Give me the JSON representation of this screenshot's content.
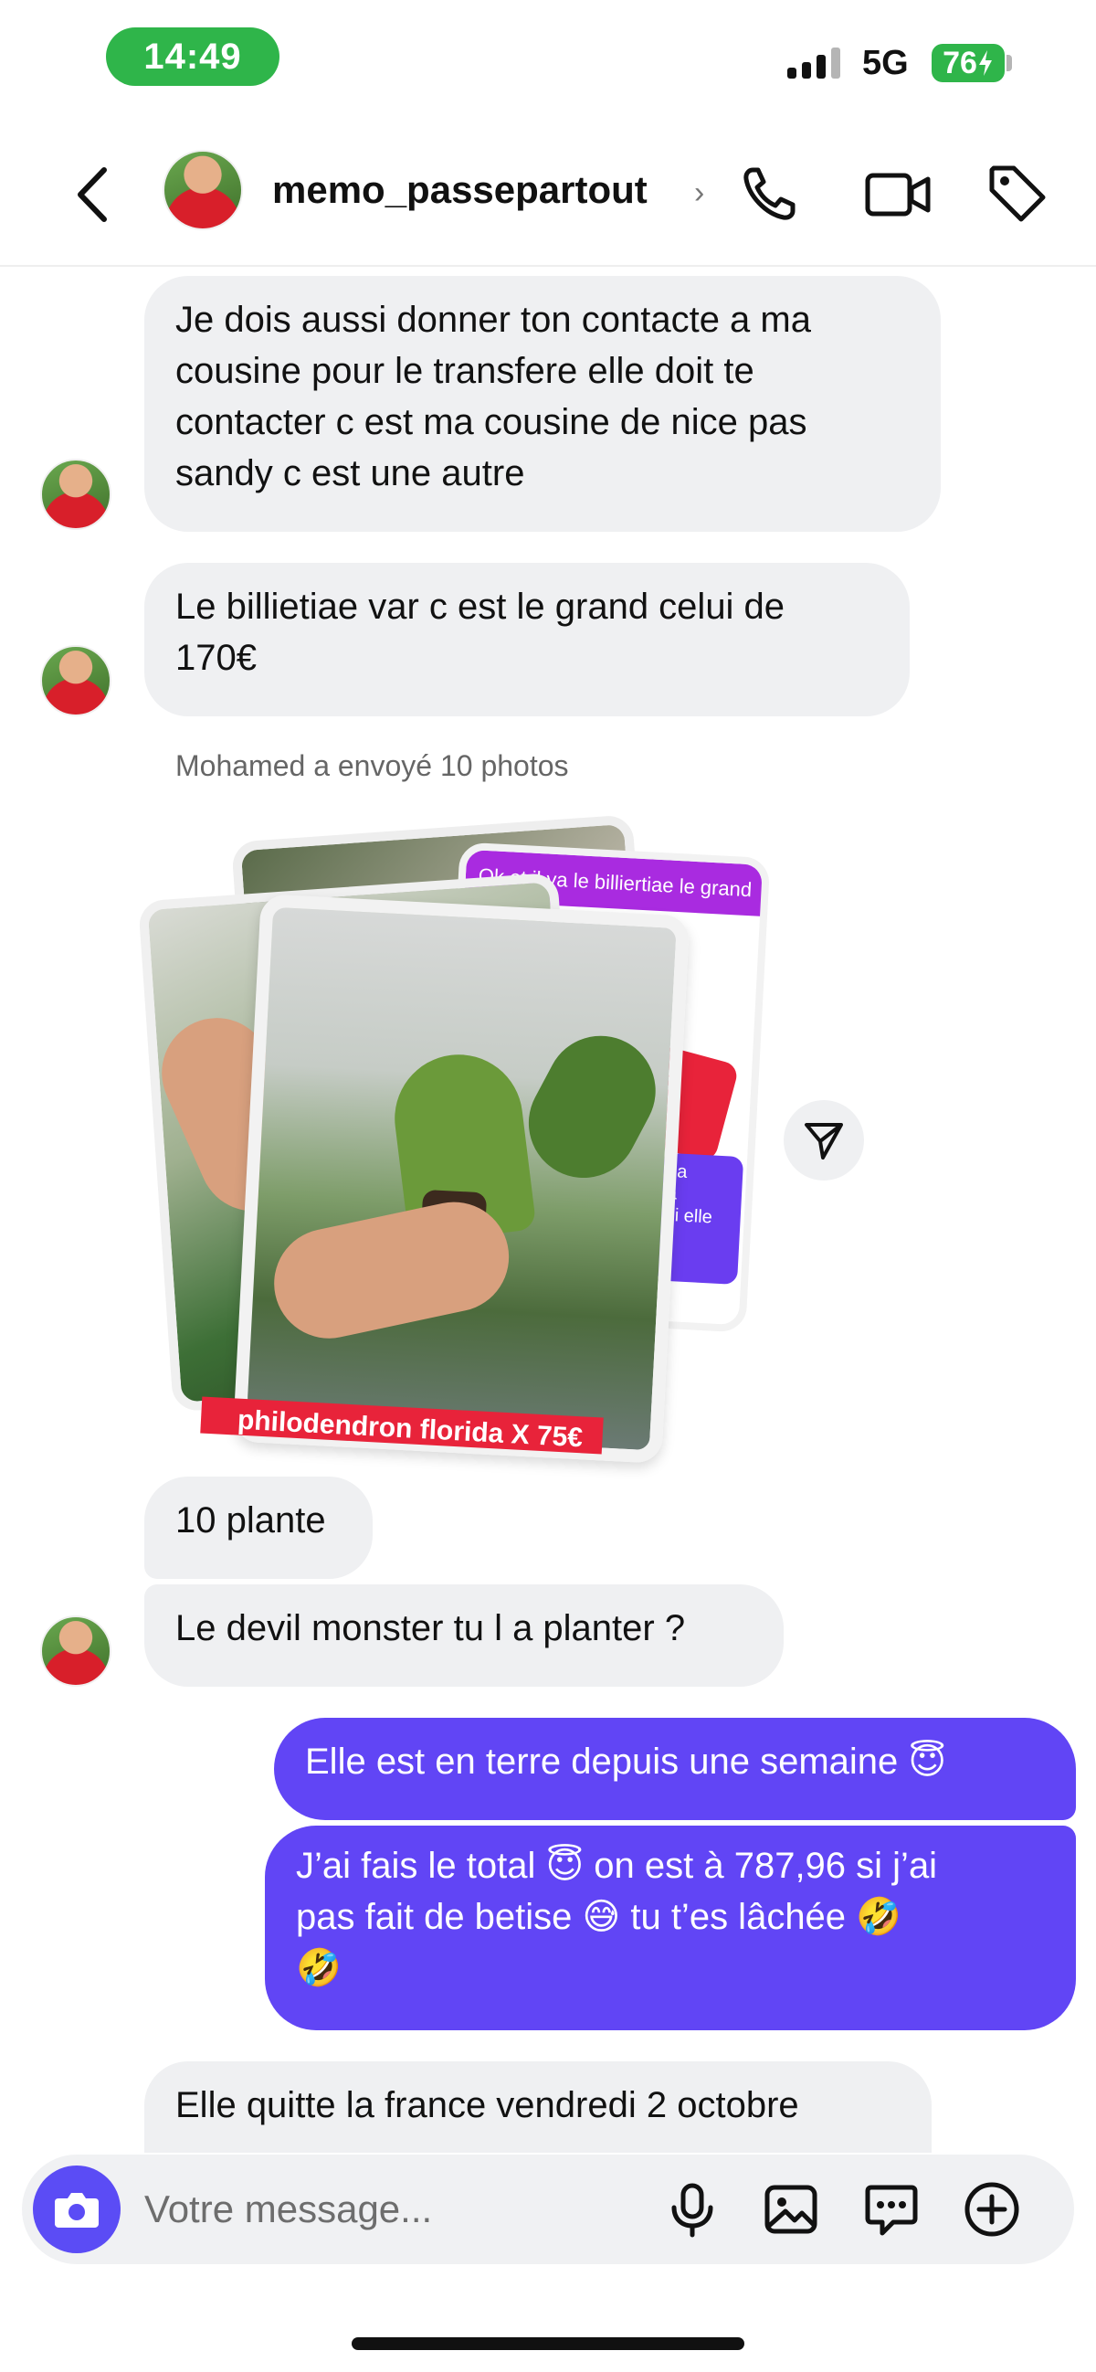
{
  "status_bar": {
    "time": "14:49",
    "network": "5G",
    "battery": "76"
  },
  "header": {
    "username": "memo_passepartout",
    "chevron": "›",
    "icons": [
      "back-icon",
      "phone-icon",
      "video-icon",
      "tag-icon"
    ]
  },
  "messages": [
    {
      "side": "in",
      "text": "Je dois aussi donner ton contacte a ma\ncousine pour le transfere elle doit te\ncontacter c est ma cousine de nice pas\nsandy c est une autre"
    },
    {
      "side": "in",
      "text": "Le billietiae var c est le grand celui de\n170€"
    },
    {
      "side": "in",
      "text": "10 plante"
    },
    {
      "side": "in",
      "text": "Le devil monster tu l a planter ?"
    },
    {
      "side": "out",
      "text": "Elle est en terre depuis une semaine 😇"
    },
    {
      "side": "out",
      "text": "J’ai fais le total 😇 on est à 787,96 si j’ai\npas fait de betise 😅 tu t’es lâchée 🤣\n🤣"
    },
    {
      "side": "in",
      "text": "Elle quitte la france vendredi 2 octobre"
    }
  ],
  "system_note": "Mohamed a envoyé 10 photos",
  "photo_stack": {
    "back_caption": "Ok et il ya le billiertiae le grand",
    "bottom_caption": "philodendron florida X 75€",
    "side_fragments": [
      "sa",
      "a",
      "si elle"
    ],
    "side_letter": "e"
  },
  "composer": {
    "placeholder": "Votre message...",
    "icons": [
      "camera-icon",
      "microphone-icon",
      "gallery-icon",
      "sticker-icon",
      "plus-icon"
    ]
  },
  "colors": {
    "outgoing": "#6145f5",
    "incoming": "#eff0f2",
    "time_pill": "#2fb54a",
    "camera_button": "#5b4cf5"
  }
}
